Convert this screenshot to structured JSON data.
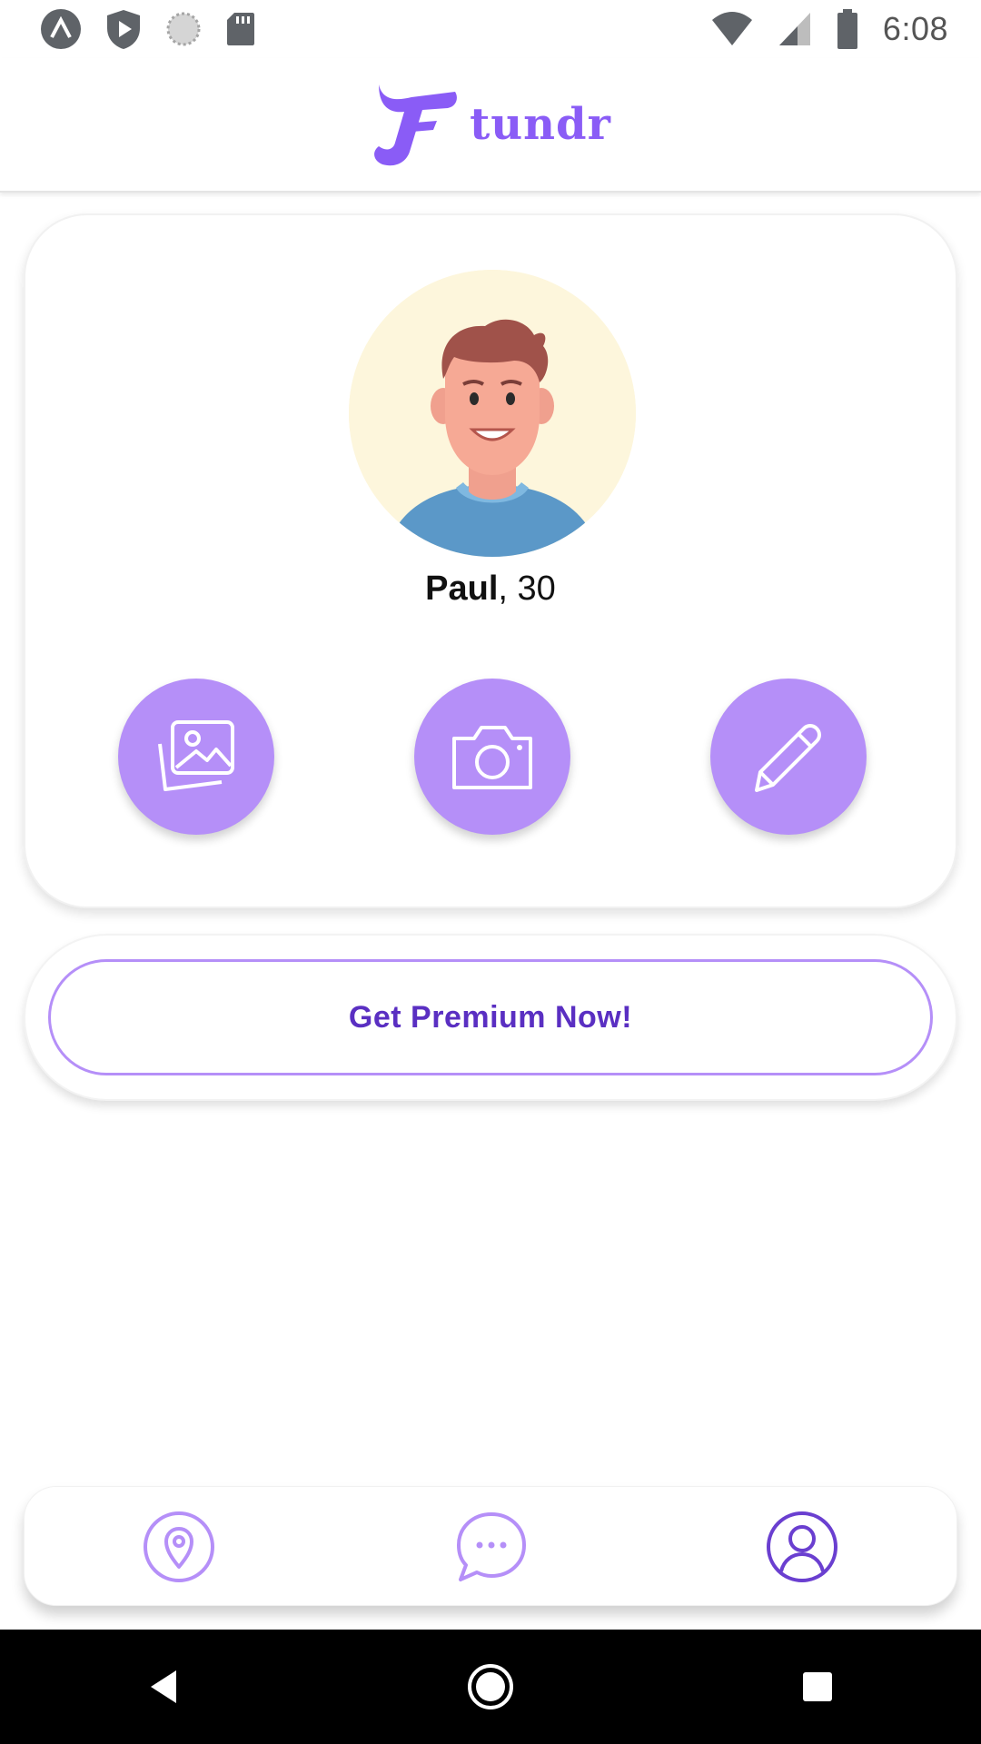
{
  "status_bar": {
    "time": "6:08",
    "left_icons": [
      "expo-icon",
      "shield-play-icon",
      "sync-icon",
      "sd-card-icon"
    ],
    "right_icons": [
      "wifi-icon",
      "signal-icon",
      "battery-icon"
    ]
  },
  "header": {
    "logo_icon": "tundr-logo-icon",
    "brand_name": "tundr"
  },
  "profile": {
    "name": "Paul",
    "separator": ", ",
    "age": "30",
    "avatar_icon": "user-avatar-illustration"
  },
  "actions": [
    {
      "name": "gallery",
      "icon": "gallery-icon"
    },
    {
      "name": "camera",
      "icon": "camera-icon"
    },
    {
      "name": "edit",
      "icon": "pencil-icon"
    }
  ],
  "premium": {
    "label": "Get Premium Now!"
  },
  "tabs": [
    {
      "name": "map",
      "icon": "location-pin-icon",
      "active": false
    },
    {
      "name": "chat",
      "icon": "chat-bubble-icon",
      "active": false
    },
    {
      "name": "profile",
      "icon": "profile-icon",
      "active": true
    }
  ],
  "colors": {
    "accent": "#b58ff8",
    "brand": "#8a5cf6",
    "premium_text": "#5a2fc2",
    "avatar_bg": "#fdf6dc"
  },
  "nav_bar": [
    "back-icon",
    "home-icon",
    "recents-icon"
  ]
}
